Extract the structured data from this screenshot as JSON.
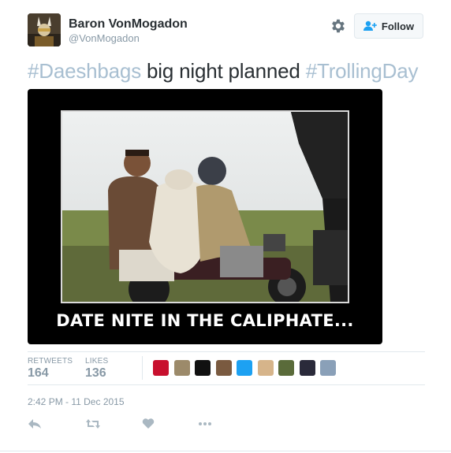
{
  "user": {
    "display_name": "Baron VonMogadon",
    "handle": "@VonMogadon"
  },
  "follow_button": {
    "label": "Follow"
  },
  "tweet": {
    "hashtag_1": "#Daeshbags",
    "text_middle": " big night planned ",
    "hashtag_2": "#TrollingDay"
  },
  "media": {
    "caption": "DATE NITE IN THE CALIPHATE..."
  },
  "stats": {
    "retweets_label": "RETWEETS",
    "retweets_value": "164",
    "likes_label": "LIKES",
    "likes_value": "136"
  },
  "likers": [
    {
      "name": "liker-1",
      "color": "#c8102e"
    },
    {
      "name": "liker-2",
      "color": "#9c8a6a"
    },
    {
      "name": "liker-3",
      "color": "#111111"
    },
    {
      "name": "liker-4",
      "color": "#7a5a40"
    },
    {
      "name": "liker-5",
      "color": "#1da1f2"
    },
    {
      "name": "liker-6",
      "color": "#d6b48a"
    },
    {
      "name": "liker-7",
      "color": "#5a6b3a"
    },
    {
      "name": "liker-8",
      "color": "#2a2a3a"
    },
    {
      "name": "liker-9",
      "color": "#8aa0b8"
    }
  ],
  "timestamp": "2:42 PM - 11 Dec 2015",
  "colors": {
    "hashtag": "#a8bfd1",
    "follow_icon": "#1da1f2",
    "muted": "#8899a6"
  },
  "icons": [
    "gear-icon",
    "add-user-icon",
    "reply-icon",
    "retweet-icon",
    "like-icon",
    "more-icon"
  ]
}
